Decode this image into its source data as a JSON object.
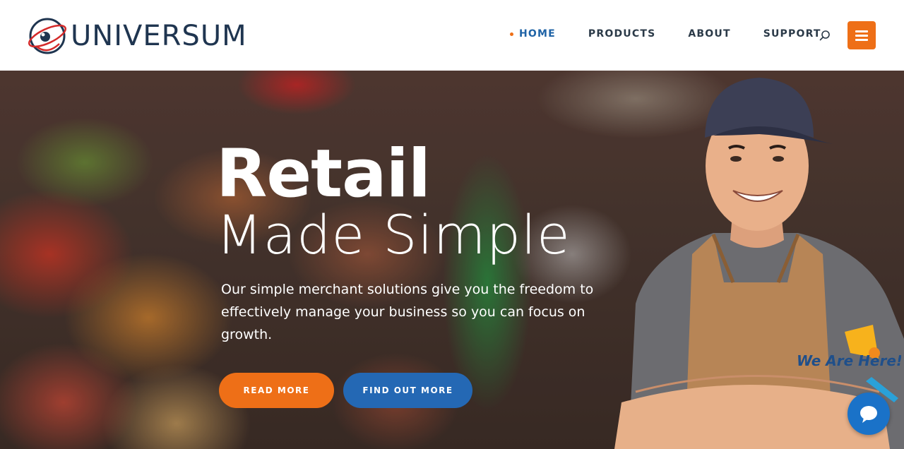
{
  "brand": {
    "name": "UNIVERSUM"
  },
  "nav": {
    "items": [
      {
        "label": "HOME",
        "active": true
      },
      {
        "label": "PRODUCTS",
        "active": false
      },
      {
        "label": "ABOUT",
        "active": false
      },
      {
        "label": "SUPPORT",
        "active": false
      }
    ],
    "search_icon": "search-icon",
    "menu_icon": "hamburger-icon"
  },
  "hero": {
    "title_line1": "Retail",
    "title_line2": "Made Simple",
    "description": "Our simple merchant solutions give you the freedom to effectively manage your business so you can focus on growth.",
    "primary_button": "READ MORE",
    "secondary_button": "FIND OUT MORE"
  },
  "widgets": {
    "promo_text": "We Are Here!",
    "chat_icon": "chat-bubble-icon"
  },
  "colors": {
    "accent": "#ee6f17",
    "blue": "#2468b4",
    "nav_text": "#2b3a48",
    "brand_text": "#1f3550"
  }
}
